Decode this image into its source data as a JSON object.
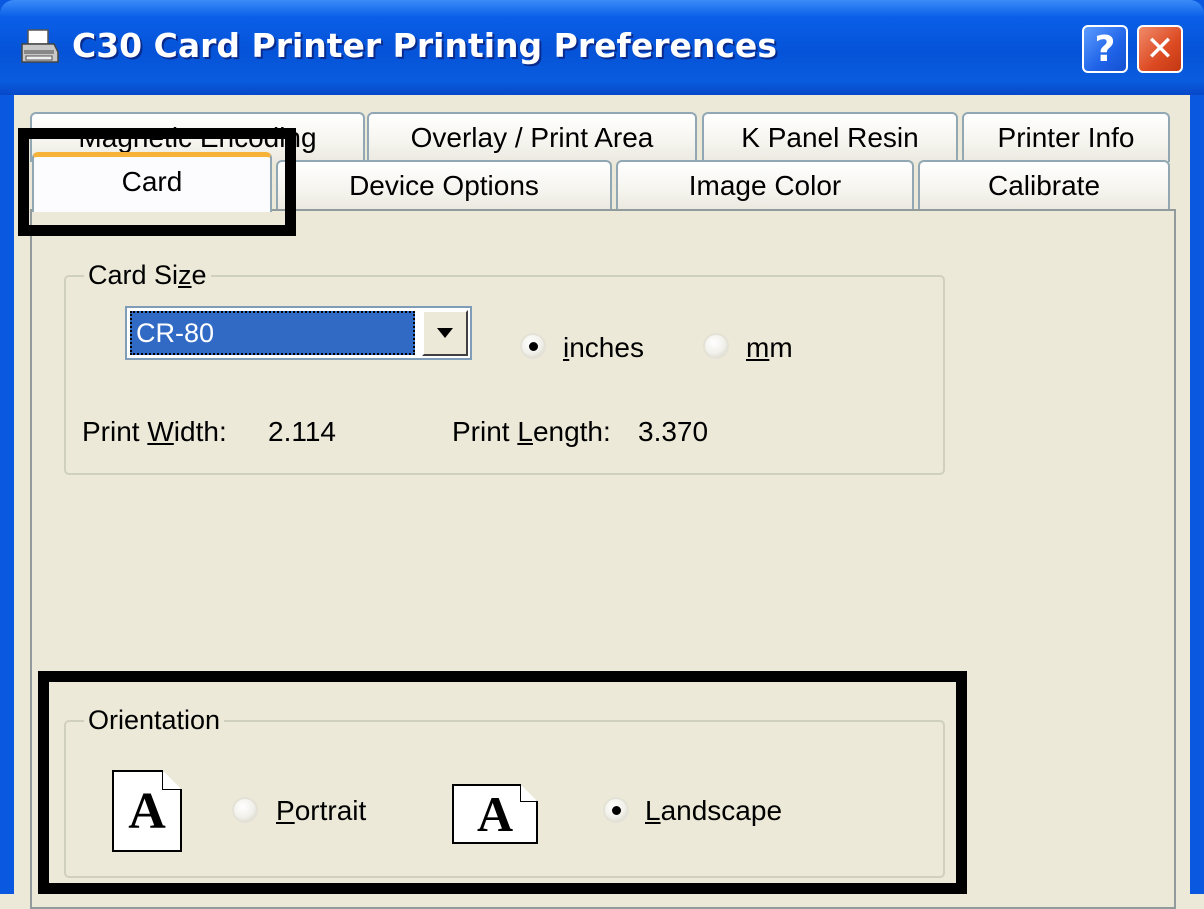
{
  "window": {
    "title": "C30 Card Printer Printing Preferences",
    "help_label": "?",
    "close_label": "✕"
  },
  "tabs_back": [
    "Magnetic Encoding",
    "Overlay / Print Area",
    "K Panel Resin",
    "Printer Info"
  ],
  "tabs_front": [
    "Card",
    "Device Options",
    "Image Color",
    "Calibrate"
  ],
  "selected_tab": "Card",
  "card_size": {
    "group_label_pre": "Card Si",
    "group_label_accel": "z",
    "group_label_post": "e",
    "selected_value": "CR-80",
    "units": [
      {
        "pre": "",
        "accel": "i",
        "post": "nches",
        "selected": true
      },
      {
        "pre": "",
        "accel": "m",
        "post": "m",
        "selected": false
      }
    ],
    "print_width_label_pre": "Print ",
    "print_width_label_accel": "W",
    "print_width_label_post": "idth:",
    "print_width_value": "2.114",
    "print_length_label_pre": "Print ",
    "print_length_label_accel": "L",
    "print_length_label_post": "ength:",
    "print_length_value": "3.370"
  },
  "orientation": {
    "group_label": "Orientation",
    "icon_letter": "A",
    "options": [
      {
        "pre": "",
        "accel": "P",
        "post": "ortrait",
        "selected": false
      },
      {
        "pre": "",
        "accel": "L",
        "post": "andscape",
        "selected": true
      }
    ]
  },
  "colors": {
    "titlebar": "#0553d8",
    "selected_tab_accent": "#f7b238",
    "selection_blue": "#316ac5",
    "annotation_box": "#000000"
  },
  "icons": [
    "printer-icon",
    "help-icon",
    "close-icon",
    "dropdown-arrow-icon",
    "portrait-page-icon",
    "landscape-page-icon"
  ]
}
